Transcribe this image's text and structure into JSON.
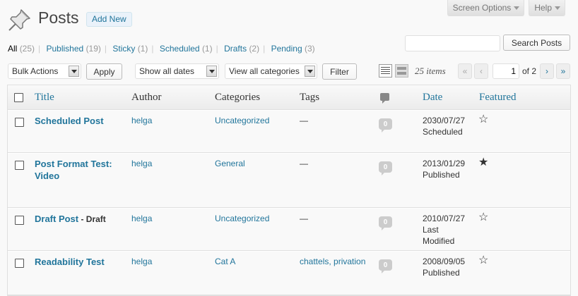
{
  "screen_tabs": {
    "screen_options": "Screen Options",
    "help": "Help"
  },
  "header": {
    "title": "Posts",
    "add_new": "Add New"
  },
  "search": {
    "button": "Search Posts",
    "value": ""
  },
  "subsubsub": [
    {
      "label": "All",
      "count": "(25)"
    },
    {
      "label": "Published",
      "count": "(19)"
    },
    {
      "label": "Sticky",
      "count": "(1)"
    },
    {
      "label": "Scheduled",
      "count": "(1)"
    },
    {
      "label": "Drafts",
      "count": "(2)"
    },
    {
      "label": "Pending",
      "count": "(3)"
    }
  ],
  "tablenav": {
    "bulk_actions": "Bulk Actions",
    "apply": "Apply",
    "dates": "Show all dates",
    "categories": "View all categories",
    "filter": "Filter",
    "items_count": "25 items",
    "first_page": "«",
    "prev_page": "‹",
    "current_page": "1",
    "of_pages": "of 2",
    "next_page": "›",
    "last_page": "»"
  },
  "columns": {
    "title": "Title",
    "author": "Author",
    "categories": "Categories",
    "tags": "Tags",
    "date": "Date",
    "featured": "Featured"
  },
  "rows": [
    {
      "title": "Scheduled Post",
      "state": "",
      "author": "helga",
      "categories": "Uncategorized",
      "tags": "—",
      "comments": "0",
      "date": "2030/07/27",
      "status": "Scheduled",
      "featured": false
    },
    {
      "title": "Post Format Test: Video",
      "state": "",
      "author": "helga",
      "categories": "General",
      "tags": "—",
      "comments": "0",
      "date": "2013/01/29",
      "status": "Published",
      "featured": true
    },
    {
      "title": "Draft Post",
      "state": " - Draft",
      "author": "helga",
      "categories": "Uncategorized",
      "tags": "—",
      "comments": "0",
      "date": "2010/07/27",
      "status": "Last Modified",
      "featured": false
    },
    {
      "title": "Readability Test",
      "state": "",
      "author": "helga",
      "categories": "Cat A",
      "tags": "chattels, privation",
      "comments": "0",
      "date": "2008/09/05",
      "status": "Published",
      "featured": false
    }
  ],
  "icons": {
    "header": "pushpin-icon",
    "star_empty": "☆",
    "star_filled": "★"
  },
  "colors": {
    "link": "#21759b",
    "badge": "#cccccc"
  }
}
